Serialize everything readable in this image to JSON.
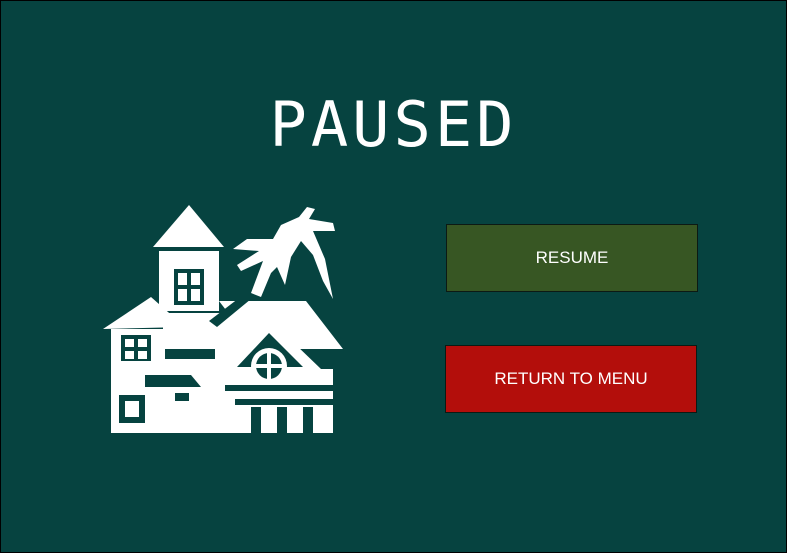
{
  "pause_menu": {
    "title": "PAUSED",
    "resume_label": "RESUME",
    "return_label": "RETURN TO MENU"
  },
  "illustration": {
    "icon": "haunted-house-icon",
    "color": "#ffffff"
  },
  "colors": {
    "background": "#064340",
    "resume_button": "#375623",
    "return_button": "#b30e0b",
    "text": "#ffffff"
  }
}
